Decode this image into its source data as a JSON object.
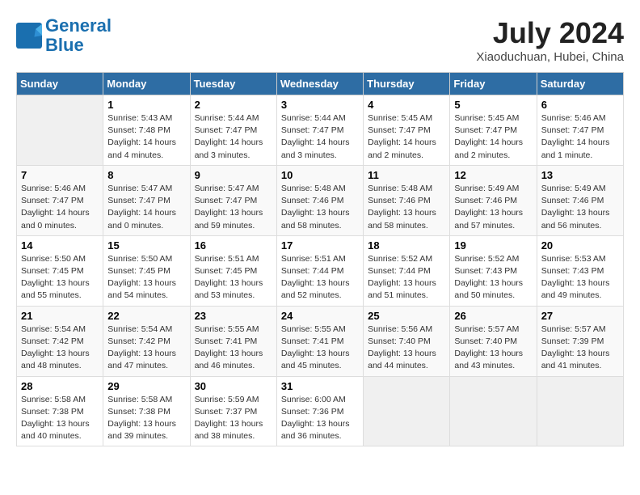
{
  "logo": {
    "line1": "General",
    "line2": "Blue"
  },
  "title": "July 2024",
  "location": "Xiaoduchuan, Hubei, China",
  "days_of_week": [
    "Sunday",
    "Monday",
    "Tuesday",
    "Wednesday",
    "Thursday",
    "Friday",
    "Saturday"
  ],
  "weeks": [
    [
      {
        "num": "",
        "info": ""
      },
      {
        "num": "1",
        "info": "Sunrise: 5:43 AM\nSunset: 7:48 PM\nDaylight: 14 hours\nand 4 minutes."
      },
      {
        "num": "2",
        "info": "Sunrise: 5:44 AM\nSunset: 7:47 PM\nDaylight: 14 hours\nand 3 minutes."
      },
      {
        "num": "3",
        "info": "Sunrise: 5:44 AM\nSunset: 7:47 PM\nDaylight: 14 hours\nand 3 minutes."
      },
      {
        "num": "4",
        "info": "Sunrise: 5:45 AM\nSunset: 7:47 PM\nDaylight: 14 hours\nand 2 minutes."
      },
      {
        "num": "5",
        "info": "Sunrise: 5:45 AM\nSunset: 7:47 PM\nDaylight: 14 hours\nand 2 minutes."
      },
      {
        "num": "6",
        "info": "Sunrise: 5:46 AM\nSunset: 7:47 PM\nDaylight: 14 hours\nand 1 minute."
      }
    ],
    [
      {
        "num": "7",
        "info": "Sunrise: 5:46 AM\nSunset: 7:47 PM\nDaylight: 14 hours\nand 0 minutes."
      },
      {
        "num": "8",
        "info": "Sunrise: 5:47 AM\nSunset: 7:47 PM\nDaylight: 14 hours\nand 0 minutes."
      },
      {
        "num": "9",
        "info": "Sunrise: 5:47 AM\nSunset: 7:47 PM\nDaylight: 13 hours\nand 59 minutes."
      },
      {
        "num": "10",
        "info": "Sunrise: 5:48 AM\nSunset: 7:46 PM\nDaylight: 13 hours\nand 58 minutes."
      },
      {
        "num": "11",
        "info": "Sunrise: 5:48 AM\nSunset: 7:46 PM\nDaylight: 13 hours\nand 58 minutes."
      },
      {
        "num": "12",
        "info": "Sunrise: 5:49 AM\nSunset: 7:46 PM\nDaylight: 13 hours\nand 57 minutes."
      },
      {
        "num": "13",
        "info": "Sunrise: 5:49 AM\nSunset: 7:46 PM\nDaylight: 13 hours\nand 56 minutes."
      }
    ],
    [
      {
        "num": "14",
        "info": "Sunrise: 5:50 AM\nSunset: 7:45 PM\nDaylight: 13 hours\nand 55 minutes."
      },
      {
        "num": "15",
        "info": "Sunrise: 5:50 AM\nSunset: 7:45 PM\nDaylight: 13 hours\nand 54 minutes."
      },
      {
        "num": "16",
        "info": "Sunrise: 5:51 AM\nSunset: 7:45 PM\nDaylight: 13 hours\nand 53 minutes."
      },
      {
        "num": "17",
        "info": "Sunrise: 5:51 AM\nSunset: 7:44 PM\nDaylight: 13 hours\nand 52 minutes."
      },
      {
        "num": "18",
        "info": "Sunrise: 5:52 AM\nSunset: 7:44 PM\nDaylight: 13 hours\nand 51 minutes."
      },
      {
        "num": "19",
        "info": "Sunrise: 5:52 AM\nSunset: 7:43 PM\nDaylight: 13 hours\nand 50 minutes."
      },
      {
        "num": "20",
        "info": "Sunrise: 5:53 AM\nSunset: 7:43 PM\nDaylight: 13 hours\nand 49 minutes."
      }
    ],
    [
      {
        "num": "21",
        "info": "Sunrise: 5:54 AM\nSunset: 7:42 PM\nDaylight: 13 hours\nand 48 minutes."
      },
      {
        "num": "22",
        "info": "Sunrise: 5:54 AM\nSunset: 7:42 PM\nDaylight: 13 hours\nand 47 minutes."
      },
      {
        "num": "23",
        "info": "Sunrise: 5:55 AM\nSunset: 7:41 PM\nDaylight: 13 hours\nand 46 minutes."
      },
      {
        "num": "24",
        "info": "Sunrise: 5:55 AM\nSunset: 7:41 PM\nDaylight: 13 hours\nand 45 minutes."
      },
      {
        "num": "25",
        "info": "Sunrise: 5:56 AM\nSunset: 7:40 PM\nDaylight: 13 hours\nand 44 minutes."
      },
      {
        "num": "26",
        "info": "Sunrise: 5:57 AM\nSunset: 7:40 PM\nDaylight: 13 hours\nand 43 minutes."
      },
      {
        "num": "27",
        "info": "Sunrise: 5:57 AM\nSunset: 7:39 PM\nDaylight: 13 hours\nand 41 minutes."
      }
    ],
    [
      {
        "num": "28",
        "info": "Sunrise: 5:58 AM\nSunset: 7:38 PM\nDaylight: 13 hours\nand 40 minutes."
      },
      {
        "num": "29",
        "info": "Sunrise: 5:58 AM\nSunset: 7:38 PM\nDaylight: 13 hours\nand 39 minutes."
      },
      {
        "num": "30",
        "info": "Sunrise: 5:59 AM\nSunset: 7:37 PM\nDaylight: 13 hours\nand 38 minutes."
      },
      {
        "num": "31",
        "info": "Sunrise: 6:00 AM\nSunset: 7:36 PM\nDaylight: 13 hours\nand 36 minutes."
      },
      {
        "num": "",
        "info": ""
      },
      {
        "num": "",
        "info": ""
      },
      {
        "num": "",
        "info": ""
      }
    ]
  ]
}
